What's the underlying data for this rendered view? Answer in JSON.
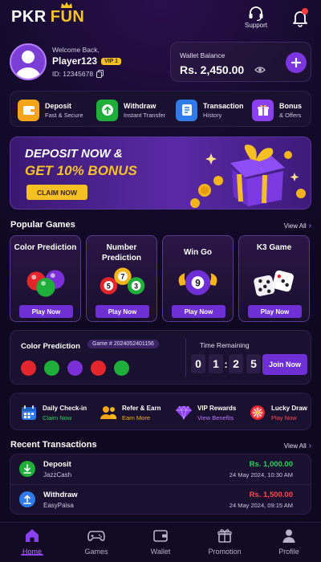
{
  "header": {
    "logo_primary": "PKR",
    "logo_secondary": "FUN",
    "support_label": "Support",
    "notification_badge": true
  },
  "profile": {
    "welcome": "Welcome Back,",
    "name": "Player123",
    "vip": "VIP 1",
    "id": "ID: 12345678"
  },
  "wallet": {
    "label": "Wallet Balance",
    "amount": "Rs. 2,450.00"
  },
  "quick_actions": [
    {
      "title": "Deposit",
      "subtitle": "Fast & Secure",
      "icon": "wallet-icon",
      "color": "#f4a417"
    },
    {
      "title": "Withdraw",
      "subtitle": "Instant Transfer",
      "icon": "withdraw-arrow-icon",
      "color": "#1fae3a"
    },
    {
      "title": "Transaction",
      "subtitle": "History",
      "icon": "document-icon",
      "color": "#2f7be8"
    },
    {
      "title": "Bonus",
      "subtitle": "& Offers",
      "icon": "gift-icon",
      "color": "#8a3ff0"
    }
  ],
  "banner": {
    "line1": "DEPOSIT NOW &",
    "line2": "GET 10% BONUS",
    "cta": "CLAIM NOW"
  },
  "popular_games": {
    "title": "Popular Games",
    "view_all": "View All",
    "items": [
      {
        "title": "Color Prediction",
        "cta": "Play Now",
        "icon": "color-balls-icon"
      },
      {
        "title": "Number Prediction",
        "cta": "Play Now",
        "icon": "number-balls-icon"
      },
      {
        "title": "Win Go",
        "cta": "Play Now",
        "icon": "nine-ball-icon"
      },
      {
        "title": "K3 Game",
        "cta": "Play Now",
        "icon": "dice-icon"
      }
    ]
  },
  "color_round": {
    "title": "Color Prediction",
    "game_no": "Game # 2024052401156",
    "ball_colors": [
      "#e2262c",
      "#1fae3a",
      "#7b2fd6",
      "#e2262c",
      "#1fae3a"
    ],
    "time_label": "Time Remaining",
    "timer": [
      "0",
      "1",
      "2",
      "5"
    ],
    "join": "Join Now"
  },
  "rewards": [
    {
      "title": "Daily Check-in",
      "subtitle": "Claim Now",
      "sub_color": "#33d45c",
      "icon": "calendar-icon"
    },
    {
      "title": "Refer & Earn",
      "subtitle": "Earn More",
      "sub_color": "#f4b41a",
      "icon": "referral-users-icon"
    },
    {
      "title": "VIP Rewards",
      "subtitle": "View Benefits",
      "sub_color": "#b57cff",
      "icon": "diamond-icon"
    },
    {
      "title": "Lucky Draw",
      "subtitle": "Play Now",
      "sub_color": "#ff4d4d",
      "icon": "wheel-icon"
    }
  ],
  "transactions": {
    "title": "Recent Transactions",
    "view_all": "View All",
    "items": [
      {
        "type": "Deposit",
        "method": "JazzCash",
        "amount": "Rs. 1,000.00",
        "amount_color": "#2fd15a",
        "date": "24 May 2024, 10:30 AM",
        "icon": "download-arrow-icon",
        "icon_color": "#1fae3a"
      },
      {
        "type": "Withdraw",
        "method": "EasyPaisa",
        "amount": "Rs. 1,500.00",
        "amount_color": "#ff4a4a",
        "date": "24 May 2024, 09:15 AM",
        "icon": "upload-arrow-icon",
        "icon_color": "#2f7be8"
      }
    ]
  },
  "nav": [
    {
      "label": "Home",
      "icon": "home-icon",
      "active": true
    },
    {
      "label": "Games",
      "icon": "gamepad-icon",
      "active": false
    },
    {
      "label": "Wallet",
      "icon": "wallet-icon",
      "active": false
    },
    {
      "label": "Promotion",
      "icon": "gift-icon",
      "active": false
    },
    {
      "label": "Profile",
      "icon": "user-icon",
      "active": false
    }
  ]
}
